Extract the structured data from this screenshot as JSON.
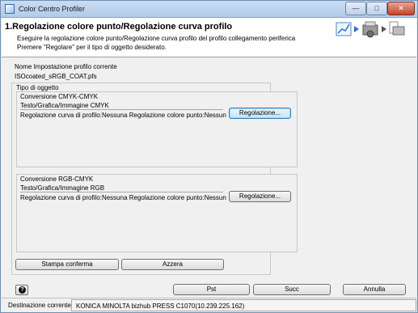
{
  "window": {
    "title": "Color Centro Profiler"
  },
  "header": {
    "title": "1.Regolazione colore punto/Regolazione curva profilo",
    "desc_line1": "Eseguire la regolazione colore punto/Regolazione curva profilo del profilo collegamento periferica",
    "desc_line2": "Premere \"Regolare\" per il tipo di oggetto desiderato."
  },
  "profile": {
    "label": "Nome Impostazione profilo corrente",
    "value": "ISOcoated_sRGB_COAT.pfs"
  },
  "object_type": {
    "label": "Tipo di oggetto",
    "cmyk": {
      "title": "Conversione CMYK-CMYK",
      "subtitle": "Testo/Grafica/Immagine CMYK",
      "status": "Regolazione curva di profilo:Nessuna Regolazione colore punto:Nessun",
      "button": "Regolazione..."
    },
    "rgb": {
      "title": "Conversione RGB-CMYK",
      "subtitle": "Testo/Grafica/Immagine RGB",
      "status": "Regolazione curva di profilo:Nessuna Regolazione colore punto:Nessun",
      "button": "Regolazione..."
    },
    "print_confirm_button": "Stampa conferma",
    "reset_button": "Azzera"
  },
  "footer": {
    "prev_button": "Pst",
    "next_button": "Succ",
    "cancel_button": "Annulla",
    "help_icon": "question-mark-icon"
  },
  "status": {
    "label": "Destinazione corrente",
    "value": "KONICA MINOLTA bizhub PRESS C1070(10.239.225.162)"
  },
  "colors": {
    "titlebar": "#c9dcf2",
    "header_bg": "#ffffff",
    "body_bg": "#f0f0f0",
    "arrow_blue": "#2a6fd6"
  }
}
